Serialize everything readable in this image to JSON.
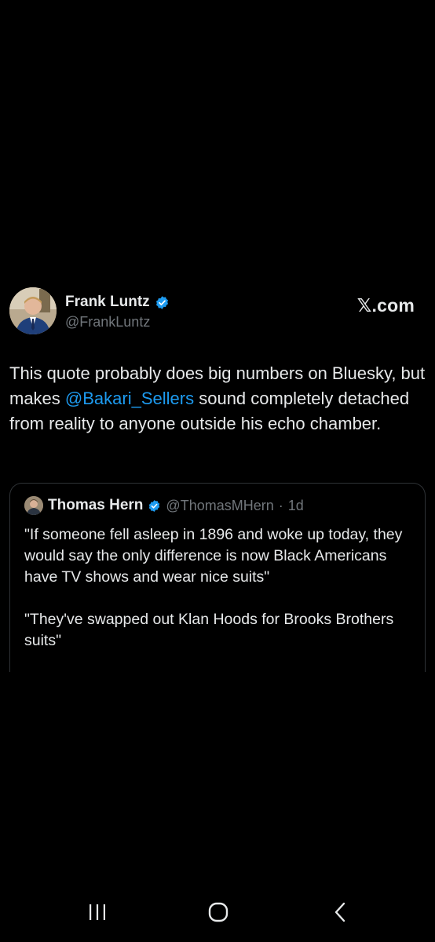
{
  "post": {
    "author_name": "Frank Luntz",
    "author_handle": "@FrankLuntz",
    "brand": "𝕏.com",
    "text_before": "This quote probably does big numbers on Bluesky, but makes ",
    "mention": "@Bakari_Sellers",
    "text_after": " sound completely detached from reality to anyone outside his echo chamber."
  },
  "quote": {
    "author_name": "Thomas Hern",
    "author_handle": "@ThomasMHern",
    "separator": "·",
    "time": "1d",
    "paragraph_1": "\"If someone fell asleep in 1896 and woke up today, they would say the only difference is now Black Americans have TV shows and wear nice suits\"",
    "paragraph_2": "\"They've swapped out Klan Hoods for Brooks Brothers suits\""
  },
  "nav": {
    "recent_icon": "recent-apps-icon",
    "home_icon": "home-icon",
    "back_icon": "back-icon"
  },
  "colors": {
    "background": "#000000",
    "text": "#e7e9ea",
    "secondary_text": "#71767b",
    "accent": "#1d9bf0",
    "card_border": "#2f3336"
  }
}
